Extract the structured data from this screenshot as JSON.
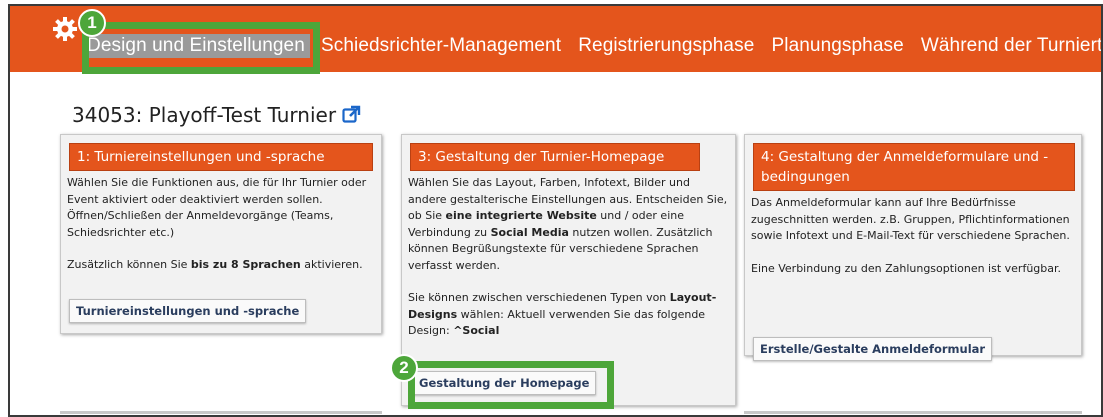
{
  "nav": {
    "items": [
      {
        "label": "Design und Einstellungen",
        "active": true
      },
      {
        "label": "Schiedsrichter-Management"
      },
      {
        "label": "Registrierungsphase"
      },
      {
        "label": "Planungsphase"
      },
      {
        "label": "Während der Turniertage"
      }
    ]
  },
  "page": {
    "title": "34053: Playoff-Test Turnier"
  },
  "badges": {
    "one": "1",
    "two": "2"
  },
  "panels": [
    {
      "header": "1: Turniereinstellungen und -sprache",
      "p1": "Wählen Sie die Funktionen aus, die für Ihr Turnier oder Event aktiviert oder deaktiviert werden sollen. Öffnen/Schließen der Anmeldevorgänge (Teams, Schiedsrichter etc.)",
      "p2_pre": "Zusätzlich können Sie ",
      "p2_bold": "bis zu 8 Sprachen",
      "p2_post": " aktivieren.",
      "button": "Turniereinstellungen und -sprache"
    },
    {
      "header": "3: Gestaltung der Turnier-Homepage",
      "p1_a": "Wählen Sie das Layout, Farben, Infotext, Bilder und andere gestalterische Einstellungen aus. Entscheiden Sie, ob Sie ",
      "p1_b": "eine integrierte Website",
      "p1_c": " und / oder eine Verbindung zu ",
      "p1_d": "Social Media",
      "p1_e": " nutzen wollen. Zusätzlich können Begrüßungstexte für verschiedene Sprachen verfasst werden.",
      "p2_a": "Sie können zwischen verschiedenen Typen von ",
      "p2_b": "Layout-Designs",
      "p2_c": " wählen: Aktuell verwenden Sie das folgende Design: ",
      "p2_d": "^Social",
      "button": "Gestaltung der Homepage"
    },
    {
      "header": "4: Gestaltung der Anmeldeformulare und -bedingungen",
      "p1": "Das Anmeldeformular kann auf Ihre Bedürfnisse zugeschnitten werden. z.B. Gruppen, Pflichtinformationen sowie Infotext und E-Mail-Text für verschiedene Sprachen.",
      "p2": "Eine Verbindung zu den Zahlungsoptionen ist verfügbar.",
      "button": "Erstelle/Gestalte Anmeldeformular"
    }
  ],
  "colors": {
    "accent": "#e4551c",
    "highlight": "#4da63a",
    "active_tab": "#9a9a9a"
  },
  "icons": {
    "logo": "gear-icon",
    "external": "external-link-icon"
  }
}
